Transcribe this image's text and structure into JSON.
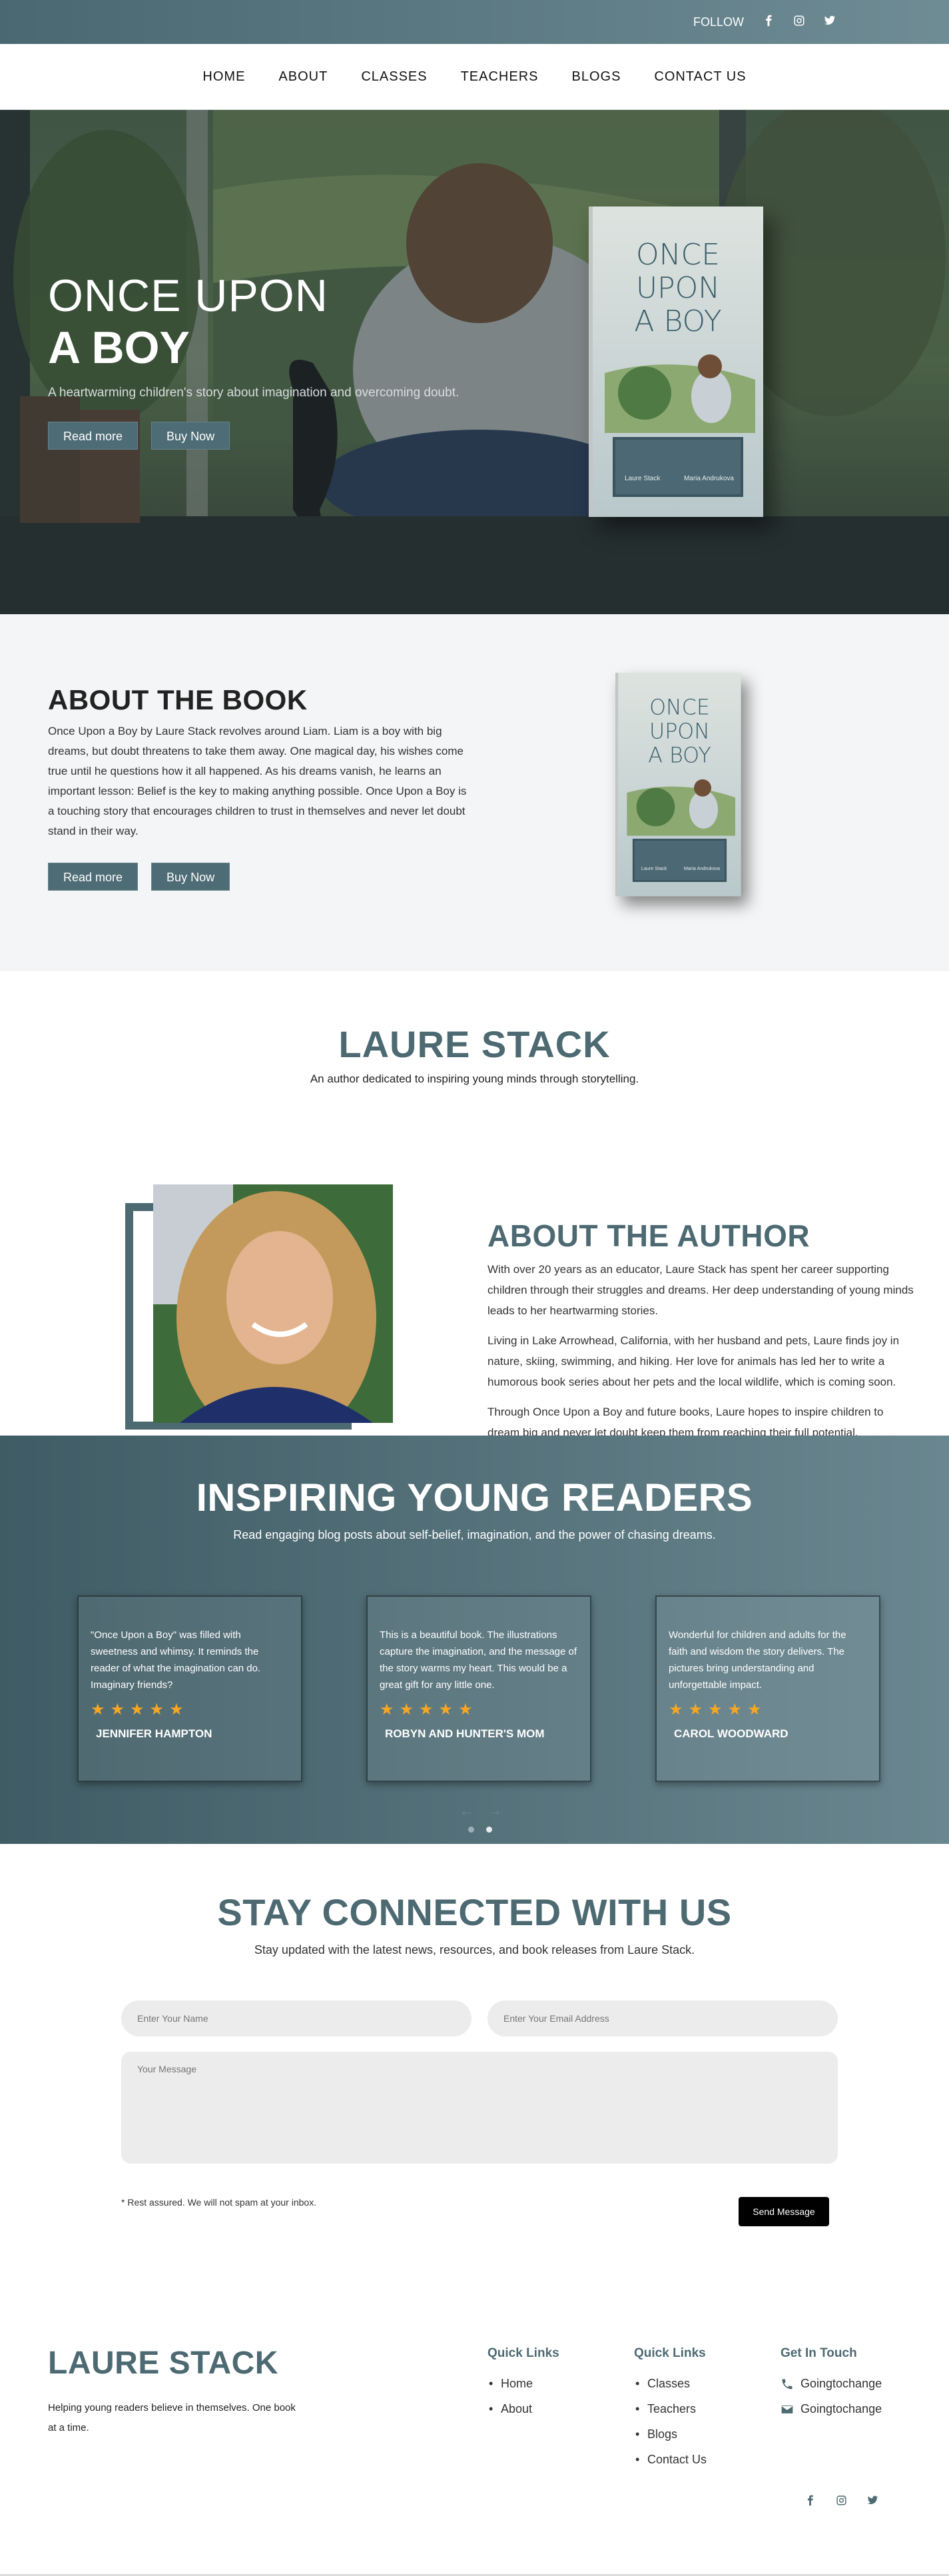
{
  "topbar": {
    "follow_label": "FOLLOW",
    "social": [
      "facebook-icon",
      "instagram-icon",
      "twitter-icon"
    ]
  },
  "nav": {
    "items": [
      "HOME",
      "ABOUT",
      "CLASSES",
      "TEACHERS",
      "BLOGS",
      "CONTACT US"
    ]
  },
  "hero": {
    "title_line1": "ONCE UPON",
    "title_line2": "A BOY",
    "subtitle": "A heartwarming children's story about imagination and overcoming doubt.",
    "read_more": "Read more",
    "buy_now": "Buy Now"
  },
  "book_cover": {
    "title_lines": [
      "ONCE",
      "UPON",
      "A BOY"
    ],
    "author": "Laure Stack",
    "illustrator": "Maria Andrukova"
  },
  "about_book": {
    "heading": "ABOUT THE BOOK",
    "body": "Once Upon a Boy by Laure Stack revolves around Liam. Liam is a boy with big dreams, but doubt threatens to take them away. One magical day, his wishes come true until he questions how it all happened. As his dreams vanish, he learns an important lesson: Belief is the key to making anything possible. Once Upon a Boy is a touching story that encourages children to trust in themselves and never let doubt stand in their way.",
    "read_more": "Read more",
    "buy_now": "Buy Now"
  },
  "author": {
    "name": "LAURE STACK",
    "tagline": "An author dedicated to inspiring young minds through storytelling.",
    "about_heading": "ABOUT THE AUTHOR",
    "paragraphs": [
      "With over 20 years as an educator, Laure Stack has spent her career supporting children through their struggles and dreams. Her deep understanding of young minds leads to her heartwarming stories.",
      "Living in Lake Arrowhead, California, with her husband and pets, Laure finds joy in nature, skiing, swimming, and hiking. Her love for animals has led her to write a humorous book series about her pets and the local wildlife, which is coming soon.",
      "Through Once Upon a Boy and future books, Laure hopes to inspire children to dream big and never let doubt keep them from reaching their full potential."
    ]
  },
  "reviews": {
    "heading": "INSPIRING YOUNG READERS",
    "subtitle": "Read engaging blog posts about self-belief, imagination, and the power of chasing dreams.",
    "items": [
      {
        "quote": "\"Once Upon a Boy\" was filled with sweetness and whimsy. It reminds the reader of what the imagination can do. Imaginary friends?",
        "stars": "★★★★★",
        "name": "JENNIFER HAMPTON"
      },
      {
        "quote": "This is a beautiful book. The illustrations capture the imagination, and the message of the story warms my heart. This would be a great gift for any little one.",
        "stars": "★★★★★",
        "name": "ROBYN AND HUNTER'S MOM"
      },
      {
        "quote": "Wonderful for children and adults for the faith and wisdom the story delivers. The pictures bring understanding and unforgettable impact.",
        "stars": "★★★★★",
        "name": "CAROL WOODWARD"
      }
    ],
    "prev": "←",
    "next": "→"
  },
  "contact": {
    "heading": "STAY CONNECTED WITH US",
    "subtitle": "Stay updated with the latest news, resources, and book releases from Laure Stack.",
    "name_placeholder": "Enter Your Name",
    "email_placeholder": "Enter Your Email Address",
    "message_placeholder": "Your Message",
    "spam_note": "* Rest assured. We will not spam at your inbox.",
    "send_label": "Send Message"
  },
  "footer": {
    "brand": "LAURE STACK",
    "tagline": "Helping young readers believe in themselves. One book at a time.",
    "col1": {
      "heading": "Quick Links",
      "links": [
        "Home",
        "About"
      ]
    },
    "col2": {
      "heading": "Quick Links",
      "links": [
        "Classes",
        "Teachers",
        "Blogs",
        "Contact Us"
      ]
    },
    "col3": {
      "heading": "Get In Touch",
      "phone": "Goingtochange",
      "email": "Goingtochange"
    }
  }
}
